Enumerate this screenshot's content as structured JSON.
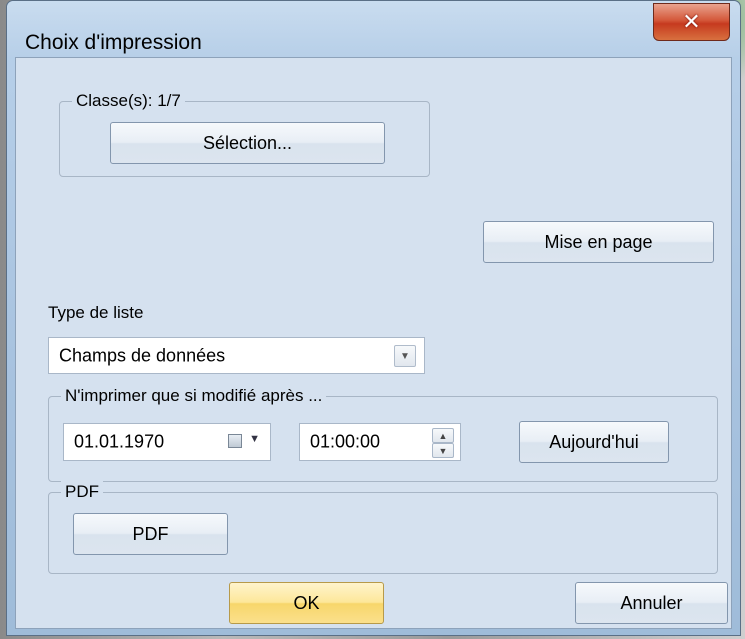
{
  "dialog": {
    "title": "Choix d'impression",
    "close_icon": "close-icon"
  },
  "classes_group": {
    "legend": "Classe(s): 1/7",
    "selection_button": "Sélection..."
  },
  "page_setup_button": "Mise en page",
  "list_type": {
    "label": "Type de liste",
    "selected": "Champs de données"
  },
  "modified_after_group": {
    "legend": "N'imprimer que si modifié après ...",
    "date": "01.01.1970",
    "time": "01:00:00",
    "today_button": "Aujourd'hui"
  },
  "pdf_group": {
    "legend": "PDF",
    "pdf_button": "PDF"
  },
  "footer": {
    "ok_button": "OK",
    "cancel_button": "Annuler"
  },
  "colors": {
    "ok_accent": "#fde79a",
    "close_button": "#c63a1f",
    "dialog_background": "#d5e1ef"
  }
}
